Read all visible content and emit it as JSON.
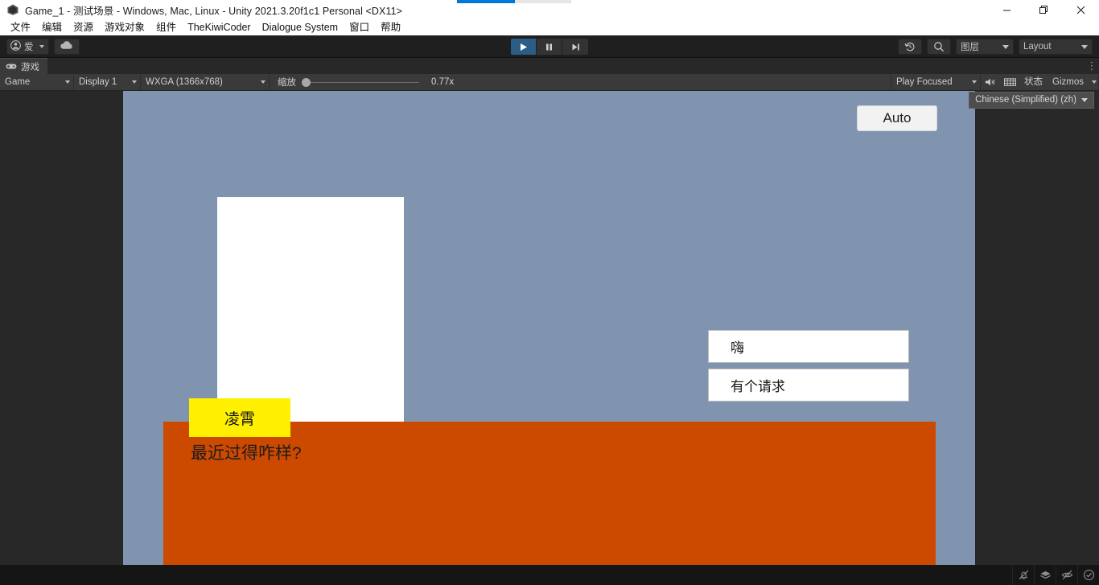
{
  "window": {
    "title": "Game_1 - 测试场景 - Windows, Mac, Linux - Unity 2021.3.20f1c1 Personal <DX11>",
    "logo_icon": "unity-logo-icon",
    "minimize_icon": "minimize-icon",
    "restore_icon": "restore-icon",
    "close_icon": "close-icon"
  },
  "progress": {
    "percent": 50
  },
  "menubar": {
    "items": [
      {
        "label": "文件"
      },
      {
        "label": "编辑"
      },
      {
        "label": "资源"
      },
      {
        "label": "游戏对象"
      },
      {
        "label": "组件"
      },
      {
        "label": "TheKiwiCoder"
      },
      {
        "label": "Dialogue System"
      },
      {
        "label": "窗口"
      },
      {
        "label": "帮助"
      }
    ]
  },
  "toolbar": {
    "account": {
      "label": "爱",
      "icon": "person-icon",
      "caret_icon": "chevron-down-icon"
    },
    "cloud": {
      "icon": "cloud-icon"
    },
    "play": {
      "icon": "play-icon",
      "active": true
    },
    "pause": {
      "icon": "pause-icon",
      "active": false
    },
    "step": {
      "icon": "step-forward-icon",
      "active": false
    },
    "history": {
      "icon": "history-undo-icon"
    },
    "search": {
      "icon": "search-icon"
    },
    "layers": {
      "label": "图层",
      "caret_icon": "chevron-down-icon"
    },
    "layout": {
      "label": "Layout",
      "caret_icon": "chevron-down-icon"
    }
  },
  "tabstrip": {
    "tab_label": "游戏",
    "tab_icon": "gamepad-icon",
    "menu_icon": "kebab-menu-icon"
  },
  "gameview_toolbar": {
    "view_mode": "Game",
    "display": "Display 1",
    "resolution": "WXGA (1366x768)",
    "scale_label": "缩放",
    "scale_value": "0.77x",
    "scale_percent": 0,
    "play_focused": "Play Focused",
    "mute_icon": "mute-audio-icon",
    "stats_grid_icon": "stats-grid-icon",
    "stats_label": "状态",
    "gizmos_label": "Gizmos",
    "caret_icon": "chevron-down-icon"
  },
  "ime": {
    "label": "Chinese (Simplified) (zh)",
    "caret_icon": "chevron-down-icon"
  },
  "game": {
    "auto_button": "Auto",
    "speaker_name": "凌霄",
    "dialogue_text": "最近过得咋样?",
    "choices": [
      {
        "label": "嗨"
      },
      {
        "label": "有个请求"
      }
    ],
    "colors": {
      "background": "#8094b0",
      "dialogue_panel": "#cc4a00",
      "nameplate": "#ffef00",
      "portrait": "#ffffff",
      "choice_bg": "#ffffff"
    }
  },
  "statusbar": {
    "message": "",
    "icons": [
      {
        "name": "mute-bell-icon"
      },
      {
        "name": "collapse-layers-icon"
      },
      {
        "name": "eye-slash-icon"
      },
      {
        "name": "check-circle-icon"
      }
    ]
  }
}
